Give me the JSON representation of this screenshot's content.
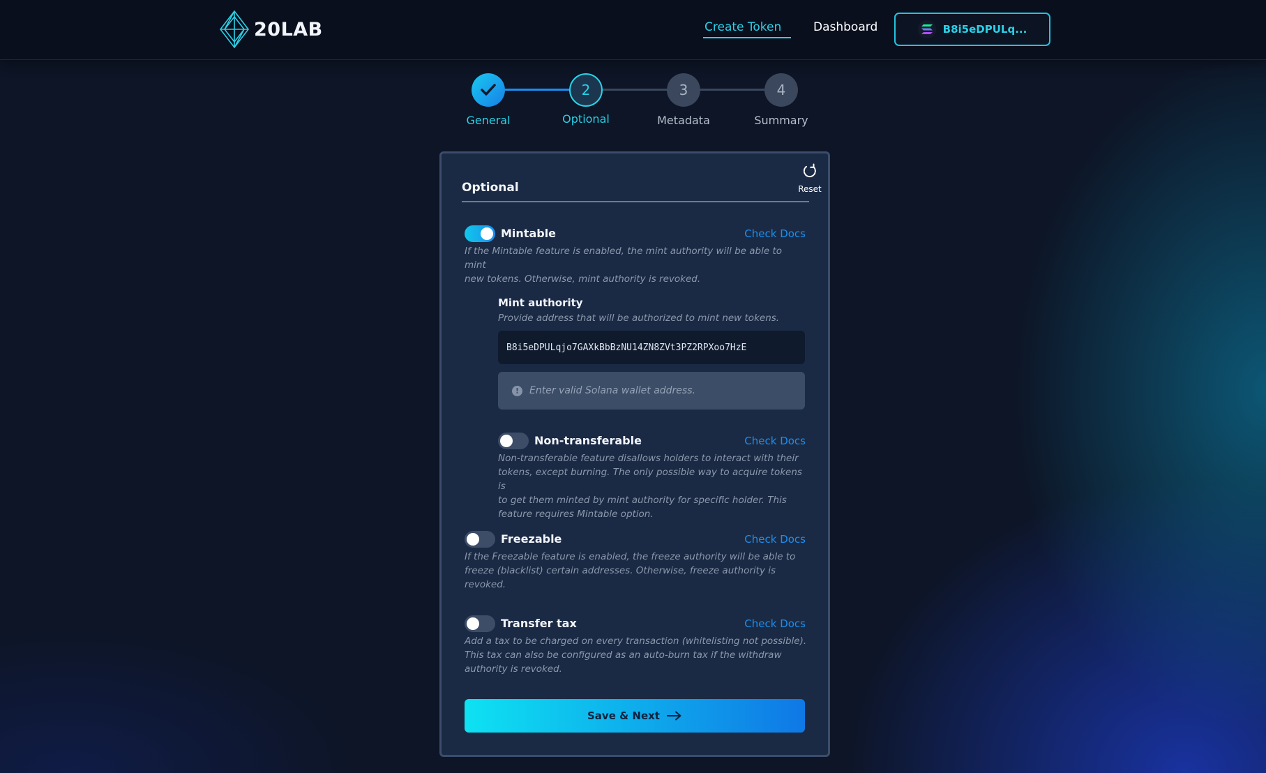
{
  "app": {
    "logo_text": "20LAB"
  },
  "nav": {
    "create_token": "Create Token",
    "dashboard": "Dashboard",
    "wallet_label": "B8i5eDPULq..."
  },
  "stepper": {
    "steps": [
      {
        "number": "1",
        "label": "General",
        "status": "complete"
      },
      {
        "number": "2",
        "label": "Optional",
        "status": "active"
      },
      {
        "number": "3",
        "label": "Metadata",
        "status": "pending"
      },
      {
        "number": "4",
        "label": "Summary",
        "status": "pending"
      }
    ]
  },
  "card": {
    "title": "Optional",
    "reset_label": "Reset",
    "features": {
      "mintable": {
        "label": "Mintable",
        "enabled": true,
        "docs_label": "Check Docs",
        "description_line1": "If the Mintable feature is enabled, the mint authority will be able to mint",
        "description_line2": "new tokens. Otherwise, mint authority is revoked."
      },
      "mint_authority": {
        "title": "Mint authority",
        "description": "Provide address that will be authorized to mint new tokens.",
        "value": "B8i5eDPULqjo7GAXkBbBzNU14ZN8ZVt3PZ2RPXoo7HzE",
        "error": "Enter valid Solana wallet address."
      },
      "non_transferable": {
        "label": "Non-transferable",
        "enabled": false,
        "docs_label": "Check Docs",
        "description_line1": "Non-transferable feature disallows holders to interact with their",
        "description_line2": "tokens, except burning. The only possible way to acquire tokens is",
        "description_line3": "to get them minted by mint authority for specific holder. This",
        "description_line4": "feature requires Mintable option."
      },
      "freezable": {
        "label": "Freezable",
        "enabled": false,
        "docs_label": "Check Docs",
        "description_line1": "If the Freezable feature is enabled, the freeze authority will be able to",
        "description_line2": "freeze (blacklist) certain addresses. Otherwise, freeze authority is",
        "description_line3": "revoked."
      },
      "transfer_tax": {
        "label": "Transfer tax",
        "enabled": false,
        "docs_label": "Check Docs",
        "description_line1": "Add a tax to be charged on every transaction (whitelisting not possible).",
        "description_line2": "This tax can also be configured as an auto-burn tax if the withdraw",
        "description_line3": "authority is revoked."
      }
    },
    "save_label": "Save & Next"
  },
  "colors": {
    "accent": "#2ad1e6",
    "link": "#1a8ff0",
    "card_bg": "#1b2a44",
    "page_bg": "#0d1526"
  },
  "icons": {
    "logo": "diamond-logo-icon",
    "wallet": "solana-icon",
    "reset": "reset-icon",
    "step_done": "check-icon",
    "error": "exclamation-icon",
    "save": "arrow-right-icon"
  }
}
